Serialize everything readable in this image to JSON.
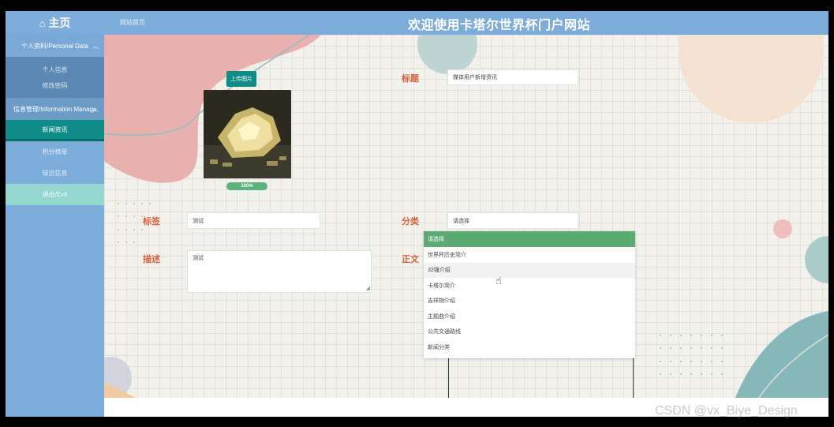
{
  "header": {
    "home_icon": "home-icon",
    "home_label": "主页",
    "breadcrumb": "网站首页",
    "site_title": "欢迎使用卡塔尔世界杯门户网站"
  },
  "sidebar": {
    "group1": {
      "label": "个人资料/Personal Data",
      "items": [
        "个人信息",
        "修改密码"
      ]
    },
    "group2": {
      "label": "信息管理/Information Manage"
    },
    "nav": [
      "新闻资讯",
      "积分榜单",
      "球员信息"
    ],
    "logout": "退出/Exit"
  },
  "form": {
    "upload_label": "上传图片",
    "progress_text": "100%",
    "progress": 1.0,
    "title_label": "标题",
    "title_value": "媒体用户新增资讯",
    "tag_label": "标签",
    "tag_value": "测试",
    "category_label": "分类",
    "category_value": "请选择",
    "desc_label": "描述",
    "desc_value": "测试",
    "content_label": "正文"
  },
  "dropdown": {
    "selected": "请选择",
    "options": [
      "世界杯历史简介",
      "32强介绍",
      "卡塔尔简介",
      "吉祥物介绍",
      "主题曲介绍",
      "公共交通路线",
      "新闻分类"
    ],
    "hovered_index": 1
  },
  "watermark": "CSDN @vx_Biye_Design",
  "colors": {
    "header_bg": "#7cacd9",
    "active_nav": "#0f8c88",
    "label_orange": "#d9613d",
    "dropdown_head": "#5bab72"
  }
}
